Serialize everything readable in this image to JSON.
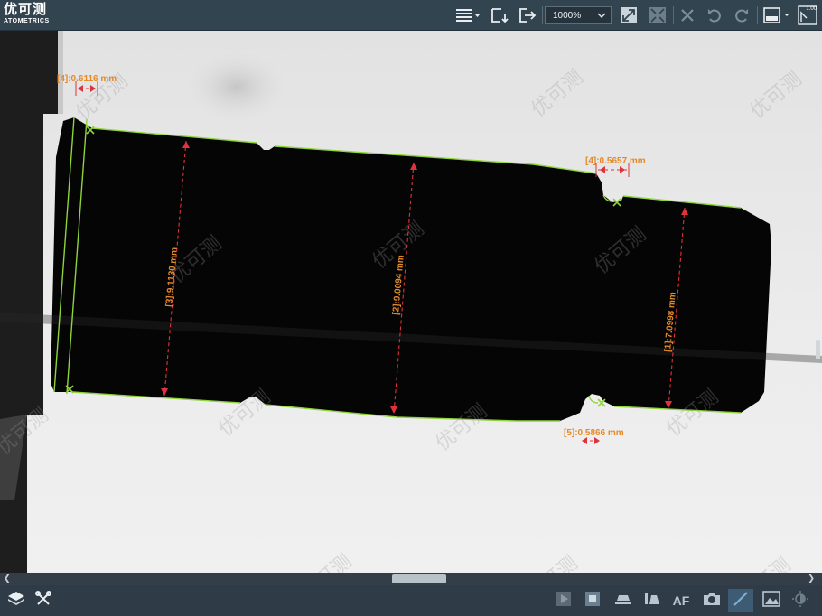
{
  "app": {
    "logo_cn": "优可测",
    "logo_en": "ATOMETRICS",
    "watermark": "优可测"
  },
  "toolbar": {
    "zoom_value": "1000%",
    "scale_badge": "1.00",
    "icons": [
      "menu-icon",
      "save-image-icon",
      "export-icon",
      "fit-window-icon",
      "original-size-icon",
      "delete-icon",
      "undo-icon",
      "redo-icon",
      "display-mode-icon",
      "scale-icon"
    ]
  },
  "measurements": [
    {
      "label": "[4]:0.6116 mm",
      "type": "width"
    },
    {
      "label": "[4]:0.5657 mm",
      "type": "width"
    },
    {
      "label": "[3]:9.1130 mm",
      "type": "distance"
    },
    {
      "label": "[2]:9.0094 mm",
      "type": "distance"
    },
    {
      "label": "[1]:7.0998 mm",
      "type": "distance"
    },
    {
      "label": "[5]:0.5866 mm",
      "type": "width"
    }
  ],
  "bottombar": {
    "af_label": "AF",
    "icons": [
      "layers-icon",
      "tools-icon",
      "play-icon",
      "stop-icon",
      "light-icon",
      "ring-light-icon",
      "autofocus-icon",
      "camera-icon",
      "measure-icon",
      "image-icon",
      "brightness-icon"
    ]
  },
  "colors": {
    "accent": "#e58a2a",
    "edge": "#8fd43a",
    "dimension": "#e0323a",
    "toolbar": "#334451"
  }
}
